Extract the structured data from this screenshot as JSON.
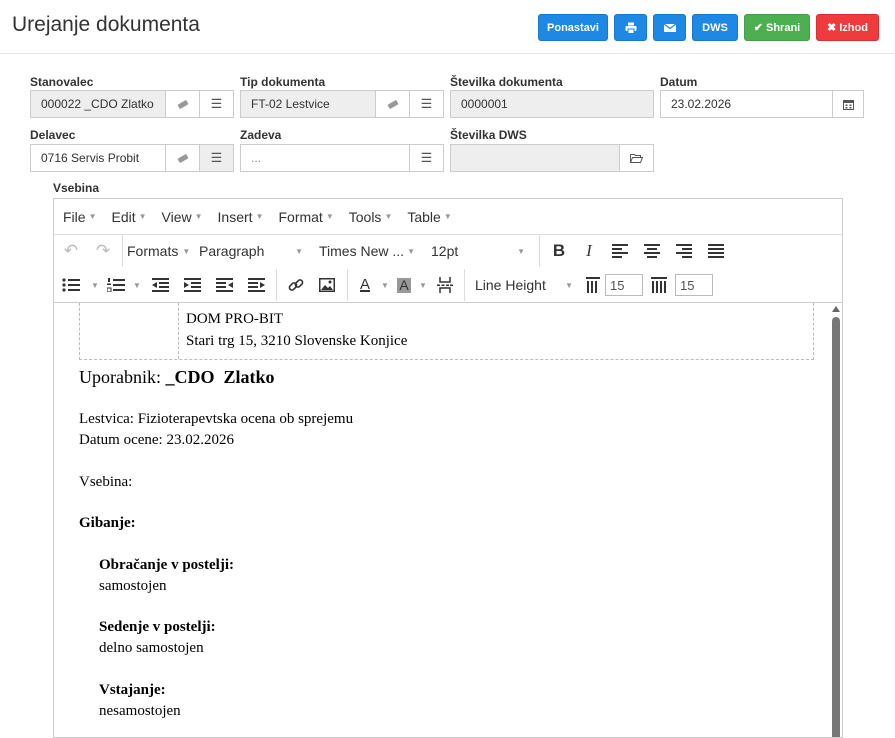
{
  "page": {
    "title": "Urejanje dokumenta"
  },
  "header_buttons": {
    "reset": "Ponastavi",
    "dws": "DWS",
    "save": "Shrani",
    "exit": "Izhod"
  },
  "form": {
    "resident": {
      "label": "Stanovalec",
      "value": "000022 _CDO Zlatko"
    },
    "doc_type": {
      "label": "Tip dokumenta",
      "value": "FT-02 Lestvice"
    },
    "doc_number": {
      "label": "Številka dokumenta",
      "value": "0000001"
    },
    "date": {
      "label": "Datum",
      "value": "23.02.2026"
    },
    "worker": {
      "label": "Delavec",
      "value": "0716 Servis Probit"
    },
    "subject": {
      "label": "Zadeva",
      "value": "..."
    },
    "dws_number": {
      "label": "Številka DWS",
      "value": ""
    },
    "content_label": "Vsebina"
  },
  "editor": {
    "menus": [
      "File",
      "Edit",
      "View",
      "Insert",
      "Format",
      "Tools",
      "Table"
    ],
    "formats": "Formats",
    "block": "Paragraph",
    "font": "Times New ...",
    "size": "12pt",
    "line_height": "Line Height",
    "spacing_before": "15",
    "spacing_after": "15"
  },
  "document": {
    "org_name": "DOM PRO-BIT",
    "org_address": "Stari trg 15, 3210 Slovenske Konjice",
    "user_label": "Uporabnik:",
    "user_name": "_CDO  Zlatko",
    "scale_line": "Lestvica: Fizioterapevtska ocena ob sprejemu",
    "date_line": "Datum ocene: 23.02.2026",
    "content_heading": "Vsebina:",
    "section": "Gibanje:",
    "items": [
      {
        "q": "Obračanje v postelji:",
        "a": "samostojen"
      },
      {
        "q": "Sedenje v postelji:",
        "a": "delno samostojen"
      },
      {
        "q": "Vstajanje:",
        "a": "nesamostojen"
      }
    ]
  }
}
